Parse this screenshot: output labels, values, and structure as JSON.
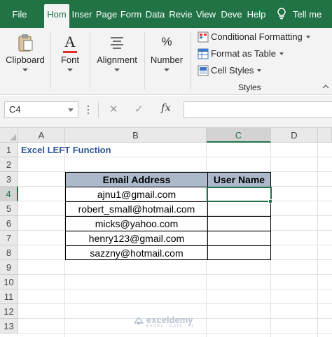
{
  "tabs": [
    {
      "label": "File",
      "active": false
    },
    {
      "label": "Hom",
      "active": true
    },
    {
      "label": "Inser",
      "active": false
    },
    {
      "label": "Page",
      "active": false
    },
    {
      "label": "Form",
      "active": false
    },
    {
      "label": "Data",
      "active": false
    },
    {
      "label": "Revie",
      "active": false
    },
    {
      "label": "View",
      "active": false
    },
    {
      "label": "Deve",
      "active": false
    },
    {
      "label": "Help",
      "active": false
    }
  ],
  "tell_me": "Tell me",
  "ribbon": {
    "clipboard": "Clipboard",
    "font": "Font",
    "alignment": "Alignment",
    "number": "Number",
    "number_icon": "%",
    "font_icon": "A",
    "conditional_formatting": "Conditional Formatting",
    "format_as_table": "Format as Table",
    "cell_styles": "Cell Styles",
    "styles_group": "Styles"
  },
  "formula_bar": {
    "name_box": "C4",
    "fx": "fx",
    "cancel_icon": "✕",
    "enter_icon": "✓",
    "formula": ""
  },
  "grid": {
    "columns": [
      {
        "label": "A",
        "selected": false
      },
      {
        "label": "B",
        "selected": false
      },
      {
        "label": "C",
        "selected": true
      },
      {
        "label": "D",
        "selected": false
      }
    ],
    "rows": [
      "1",
      "2",
      "3",
      "4",
      "5",
      "6",
      "7",
      "8",
      "9",
      "10",
      "11",
      "12",
      "13"
    ],
    "selected_row": "4",
    "a1": "Excel LEFT Function",
    "table": {
      "headers": [
        "Email Address",
        "User Name"
      ],
      "rows": [
        [
          "ajnu1@gmail.com",
          ""
        ],
        [
          "robert_small@hotmail.com",
          ""
        ],
        [
          "micks@yahoo.com",
          ""
        ],
        [
          "henry123@gmail.com",
          ""
        ],
        [
          "sazzny@hotmail.com",
          ""
        ]
      ]
    }
  },
  "watermark": {
    "name": "exceldemy",
    "tagline": "EXCEL · DATA · BI"
  },
  "colors": {
    "excel_green": "#217346",
    "title_blue": "#2e5597",
    "header_fill": "#acb9ca"
  }
}
